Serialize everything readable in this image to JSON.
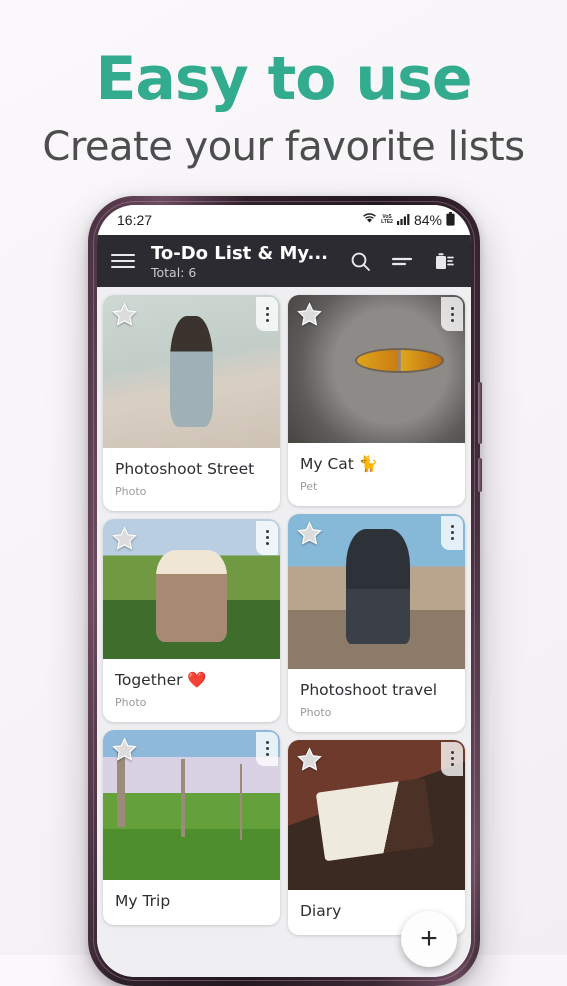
{
  "promo": {
    "headline": "Easy to use",
    "subheadline": "Create your favorite lists",
    "accent_color": "#33ab8e",
    "subheadline_color": "#4d4d4d",
    "background_color": "#f7f5f8"
  },
  "device": {
    "frame_color": "#3a2733",
    "status_bar": {
      "time": "16:27",
      "wifi_icon": "wifi-icon",
      "volte_label_top": "VoS",
      "volte_label_bottom": "LTE2",
      "signal_icon": "signal-bars-icon",
      "battery_percent": "84%",
      "battery_icon": "battery-icon"
    }
  },
  "appbar": {
    "background_color": "#2b2b31",
    "menu_icon": "hamburger-menu-icon",
    "title": "To-Do List & My...",
    "subtitle": "Total: 6",
    "actions": [
      {
        "name": "search-icon",
        "label": "Search"
      },
      {
        "name": "sort-icon",
        "label": "Sort"
      },
      {
        "name": "trash-icon",
        "label": "Delete"
      }
    ]
  },
  "cards": [
    {
      "title": "Photoshoot Street",
      "subtitle": "Photo",
      "photo_class": "ph1",
      "thumb_height": 153,
      "starred": true
    },
    {
      "title": "Together ❤️",
      "subtitle": "Photo",
      "photo_class": "ph3",
      "thumb_height": 140,
      "starred": true
    },
    {
      "title": "My Trip",
      "subtitle": "",
      "photo_class": "ph5",
      "thumb_height": 150,
      "starred": true
    },
    {
      "title": "My Cat 🐈",
      "subtitle": "Pet",
      "photo_class": "ph2",
      "thumb_height": 148,
      "starred": true
    },
    {
      "title": "Photoshoot travel",
      "subtitle": "Photo",
      "photo_class": "ph4",
      "thumb_height": 155,
      "starred": true
    },
    {
      "title": "Diary",
      "subtitle": "",
      "photo_class": "ph6",
      "thumb_height": 150,
      "starred": true
    }
  ],
  "fab": {
    "label": "+",
    "name": "add-list-button"
  },
  "card_menu_icon": "more-vertical-icon",
  "favorite_icon": "star-icon"
}
